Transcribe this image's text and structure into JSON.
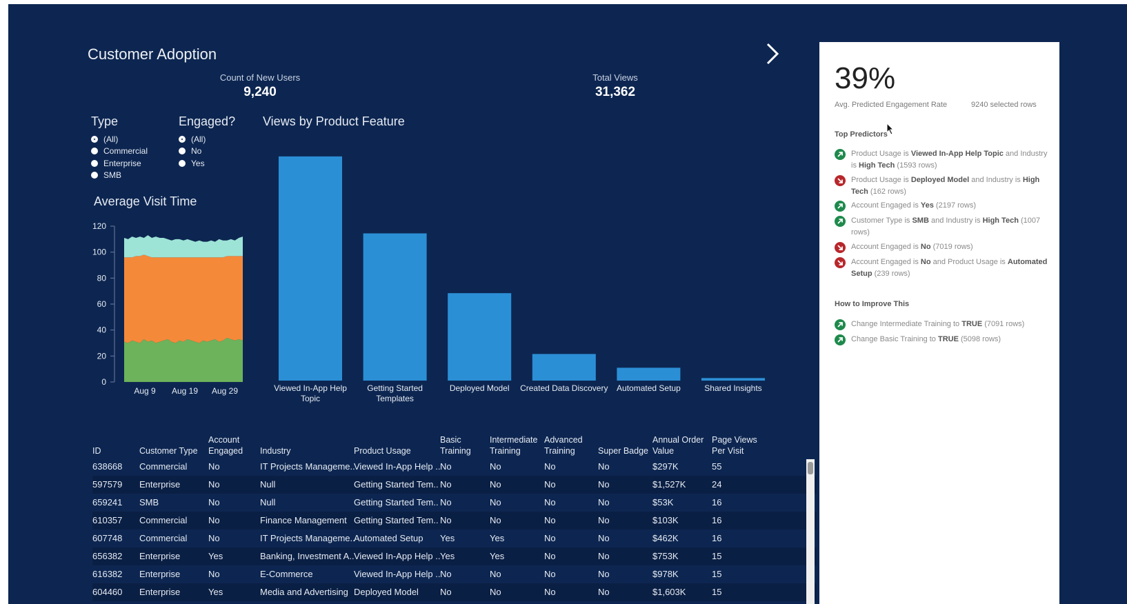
{
  "dashboard": {
    "title": "Customer Adoption",
    "kpis": [
      {
        "label": "Count of New Users",
        "value": "9,240"
      },
      {
        "label": "Total Views",
        "value": "31,362"
      }
    ]
  },
  "filters": {
    "type": {
      "title": "Type",
      "options": [
        "(All)",
        "Commercial",
        "Enterprise",
        "SMB"
      ],
      "selected": "(All)"
    },
    "engaged": {
      "title": "Engaged?",
      "options": [
        "(All)",
        "No",
        "Yes"
      ],
      "selected": "(All)"
    }
  },
  "nav": {
    "icon": "chevron-right-icon"
  },
  "colors": {
    "background": "#0d2651",
    "bar": "#2b8fd6",
    "area_top": "#9de3d6",
    "area_mid": "#f5893a",
    "area_bottom": "#6cb35b",
    "positive": "#1e8a4c",
    "negative": "#b8272b"
  },
  "chart_data": [
    {
      "type": "area",
      "title": "Average Visit Time",
      "stacked": true,
      "x_ticks": [
        "Aug 9",
        "Aug 19",
        "Aug 29"
      ],
      "ylim": [
        0,
        120
      ],
      "y_ticks": [
        0,
        20,
        40,
        60,
        80,
        100,
        120
      ],
      "grid": false,
      "x_count": 31,
      "series": [
        {
          "values": [
            31,
            30,
            32,
            31,
            30,
            33,
            31,
            32,
            30,
            31,
            32,
            33,
            31,
            30,
            32,
            31,
            33,
            32,
            31,
            30,
            32,
            31,
            32,
            33,
            31,
            32,
            34,
            33,
            32,
            33,
            32
          ]
        },
        {
          "values": [
            65,
            66,
            64,
            66,
            67,
            65,
            66,
            64,
            66,
            65,
            64,
            63,
            65,
            66,
            64,
            65,
            63,
            64,
            65,
            66,
            64,
            65,
            64,
            63,
            65,
            64,
            63,
            64,
            65,
            64,
            65
          ]
        },
        {
          "values": [
            15,
            14,
            16,
            14,
            15,
            13,
            16,
            15,
            16,
            15,
            15,
            14,
            13,
            14,
            14,
            13,
            14,
            13,
            12,
            13,
            12,
            12,
            13,
            12,
            14,
            13,
            12,
            13,
            12,
            14,
            15
          ]
        }
      ]
    },
    {
      "type": "bar",
      "title": "Views by Product Feature",
      "categories": [
        "Viewed In-App Help Topic",
        "Getting Started Templates",
        "Deployed Model",
        "Created Data Discovery",
        "Automated Setup",
        "Shared Insights"
      ],
      "values": [
        15000,
        9850,
        5850,
        1780,
        860,
        170
      ],
      "ylim": [
        0,
        15500
      ]
    }
  ],
  "table": {
    "headers": [
      "ID",
      "Customer Type",
      "Account\nEngaged",
      "Industry",
      "Product Usage",
      "Basic\nTraining",
      "Intermediate\nTraining",
      "Advanced\nTraining",
      "Super Badge",
      "Annual Order\nValue",
      "Page Views\nPer Visit"
    ],
    "rows": [
      [
        "638668",
        "Commercial",
        "No",
        "IT Projects Manageme..",
        "Viewed In-App Help ..",
        "No",
        "No",
        "No",
        "No",
        "$297K",
        "55"
      ],
      [
        "597579",
        "Enterprise",
        "No",
        "Null",
        "Getting Started Tem..",
        "No",
        "No",
        "No",
        "No",
        "$1,527K",
        "24"
      ],
      [
        "659241",
        "SMB",
        "No",
        "Null",
        "Getting Started Tem..",
        "No",
        "No",
        "No",
        "No",
        "$53K",
        "16"
      ],
      [
        "610357",
        "Commercial",
        "No",
        "Finance Management",
        "Getting Started Tem..",
        "No",
        "No",
        "No",
        "No",
        "$103K",
        "16"
      ],
      [
        "607748",
        "Commercial",
        "No",
        "IT Projects Manageme..",
        "Automated Setup",
        "Yes",
        "Yes",
        "No",
        "No",
        "$462K",
        "16"
      ],
      [
        "656382",
        "Enterprise",
        "Yes",
        "Banking, Investment A..",
        "Viewed In-App Help ..",
        "Yes",
        "Yes",
        "No",
        "No",
        "$753K",
        "15"
      ],
      [
        "616382",
        "Enterprise",
        "No",
        "E-Commerce",
        "Viewed In-App Help ..",
        "No",
        "No",
        "No",
        "No",
        "$978K",
        "15"
      ],
      [
        "604460",
        "Enterprise",
        "Yes",
        "Media and Advertising",
        "Deployed Model",
        "No",
        "No",
        "No",
        "No",
        "$1,603K",
        "15"
      ]
    ]
  },
  "panel": {
    "rate": "39%",
    "rate_label": "Avg. Predicted Engagement Rate",
    "rows_label": "9240 selected rows",
    "top_predictors_title": "Top Predictors",
    "top_predictors": [
      {
        "direction": "up",
        "parts": [
          [
            "Product Usage is ",
            false
          ],
          [
            "Viewed In-App Help Topic",
            true
          ],
          [
            " and Industry is ",
            false
          ],
          [
            "High Tech",
            true
          ],
          [
            " (1593 rows)",
            false
          ]
        ]
      },
      {
        "direction": "down",
        "parts": [
          [
            "Product Usage is ",
            false
          ],
          [
            "Deployed Model",
            true
          ],
          [
            " and Industry is ",
            false
          ],
          [
            "High Tech",
            true
          ],
          [
            " (162 rows)",
            false
          ]
        ]
      },
      {
        "direction": "up",
        "parts": [
          [
            "Account Engaged is ",
            false
          ],
          [
            "Yes",
            true
          ],
          [
            " (2197 rows)",
            false
          ]
        ]
      },
      {
        "direction": "up",
        "parts": [
          [
            "Customer Type is ",
            false
          ],
          [
            "SMB",
            true
          ],
          [
            " and Industry is ",
            false
          ],
          [
            "High Tech",
            true
          ],
          [
            " (1007 rows)",
            false
          ]
        ]
      },
      {
        "direction": "down",
        "parts": [
          [
            "Account Engaged is ",
            false
          ],
          [
            "No",
            true
          ],
          [
            " (7019 rows)",
            false
          ]
        ]
      },
      {
        "direction": "down",
        "parts": [
          [
            "Account Engaged is ",
            false
          ],
          [
            "No",
            true
          ],
          [
            " and Product Usage is ",
            false
          ],
          [
            "Automated Setup",
            true
          ],
          [
            " (239 rows)",
            false
          ]
        ]
      }
    ],
    "improve_title": "How to Improve This",
    "improve": [
      {
        "direction": "up",
        "parts": [
          [
            "Change Intermediate Training to ",
            false
          ],
          [
            "TRUE",
            true
          ],
          [
            " (7091 rows)",
            false
          ]
        ]
      },
      {
        "direction": "up",
        "parts": [
          [
            "Change Basic Training to ",
            false
          ],
          [
            "TRUE",
            true
          ],
          [
            " (5098 rows)",
            false
          ]
        ]
      }
    ]
  }
}
